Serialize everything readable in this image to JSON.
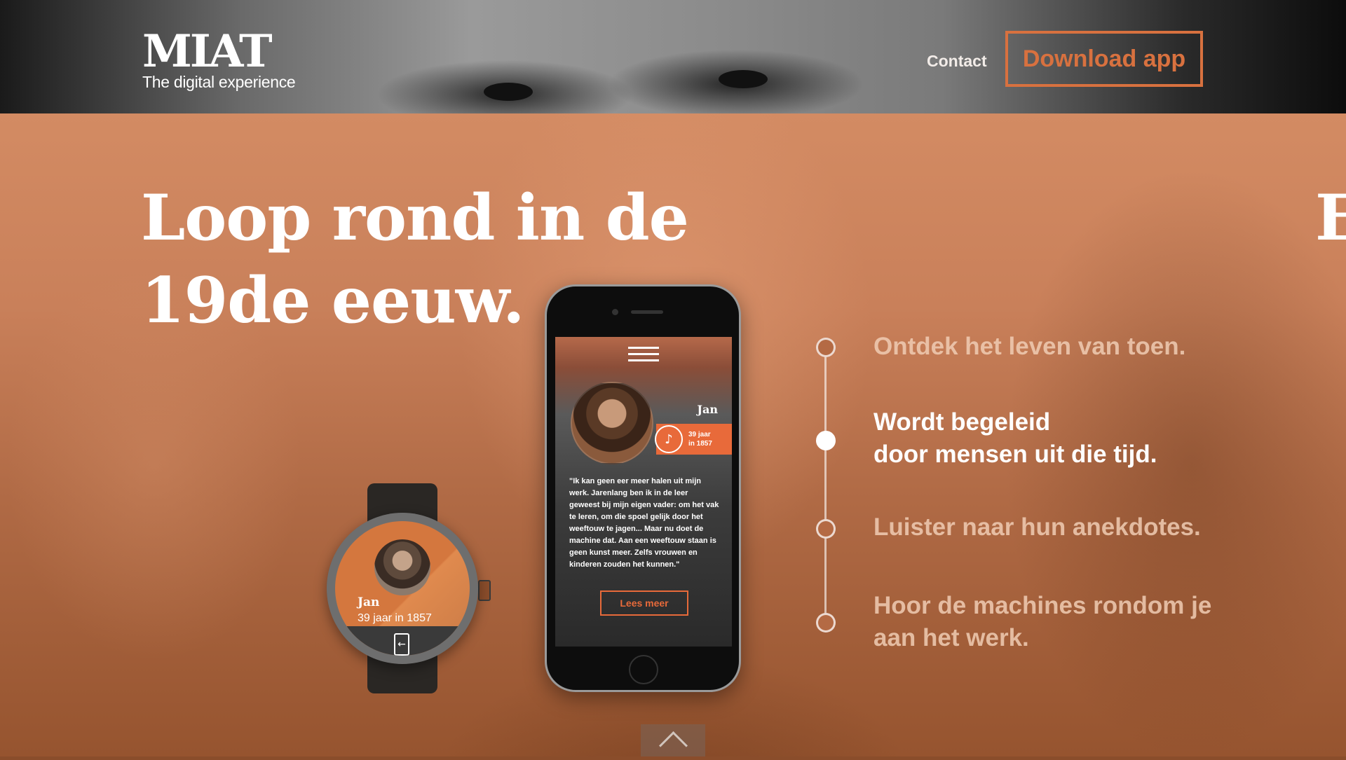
{
  "header": {
    "logo_mark": "MIAT",
    "logo_tagline": "The digital experience",
    "nav_contact": "Contact",
    "download_label": "Download app"
  },
  "hero": {
    "title_line1": "Loop rond in de",
    "title_line2": "19de eeuw.",
    "next_slide_letter": "E"
  },
  "phone": {
    "menu_icon": "hamburger-icon",
    "name": "Jan",
    "age_line1": "39 jaar",
    "age_line2": "in 1857",
    "audio_icon": "headphones-icon",
    "quote": "\"Ik kan geen eer meer halen uit mijn werk. Jarenlang ben ik in de leer geweest bij mijn eigen vader: om het vak te leren, om die spoel gelijk door het weeftouw te jagen... Maar nu doet de machine dat. Aan een weeftouw staan is geen kunst meer. Zelfs vrouwen en kinderen zouden het kunnen.\"",
    "read_more": "Lees meer"
  },
  "watch": {
    "name": "Jan",
    "age": "39 jaar in 1857",
    "action_icon": "phone-link-icon"
  },
  "timeline": {
    "items": [
      {
        "line1": "Ontdek het leven van toen.",
        "line2": "",
        "active": false
      },
      {
        "line1": "Wordt begeleid",
        "line2": "door mensen uit die tijd.",
        "active": true
      },
      {
        "line1": "Luister naar hun anekdotes.",
        "line2": "",
        "active": false
      },
      {
        "line1": "Hoor de machines rondom je",
        "line2": "aan het werk.",
        "active": false
      }
    ]
  },
  "scroll": {
    "icon": "chevron-up-icon"
  },
  "colors": {
    "accent": "#d8713f",
    "overlay": "#c9805a",
    "text": "#ffffff"
  }
}
